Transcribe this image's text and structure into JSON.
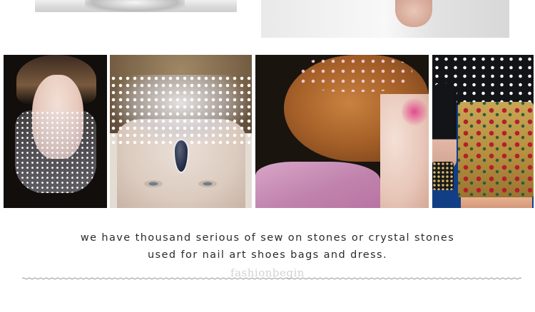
{
  "caption": {
    "line1": "we have thousand serious of sew on stones or crystal stones",
    "line2": "used for nail art shoes bags and dress."
  },
  "watermark": "fashionbegin",
  "colors": {
    "text": "#2b2b2b",
    "watermark": "#d3d3d3",
    "divider": "#9a9a9a",
    "background": "#ffffff"
  }
}
